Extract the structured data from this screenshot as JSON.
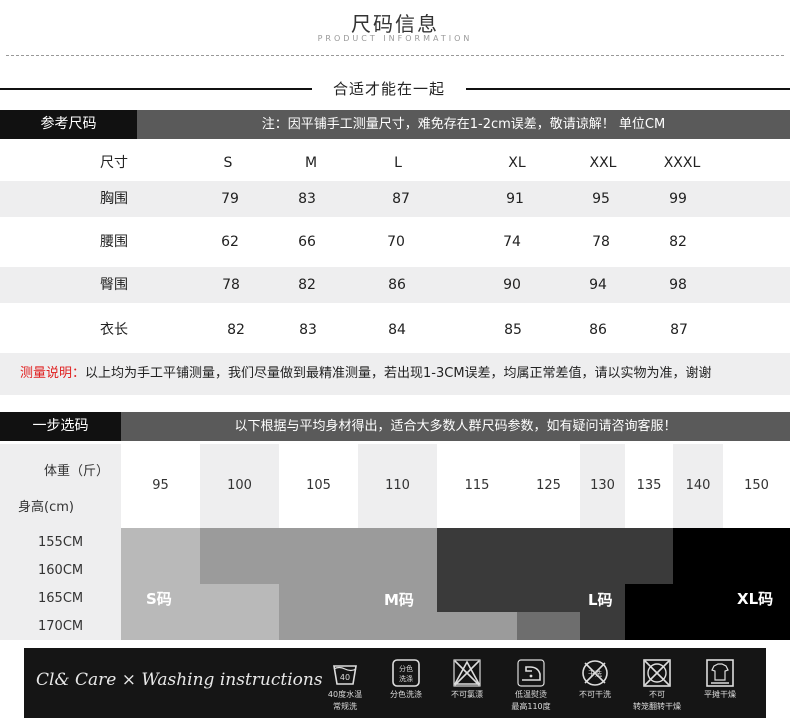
{
  "header": {
    "title": "尺码信息",
    "subtitle": "PRODUCT INFORMATION",
    "slogan": "合适才能在一起"
  },
  "ref": {
    "label": "参考尺码",
    "note": "注：因平铺手工测量尺寸，难免存在1-2cm误差，敬请谅解！ 单位CM"
  },
  "size_table": {
    "header": [
      "尺寸",
      "S",
      "M",
      "L",
      "XL",
      "XXL",
      "XXXL"
    ],
    "rows": [
      [
        "胸围",
        "79",
        "83",
        "87",
        "91",
        "95",
        "99"
      ],
      [
        "腰围",
        "62",
        "66",
        "70",
        "74",
        "78",
        "82"
      ],
      [
        "臀围",
        "78",
        "82",
        "86",
        "90",
        "94",
        "98"
      ],
      [
        "衣长",
        "82",
        "83",
        "84",
        "85",
        "86",
        "87"
      ]
    ]
  },
  "measure_note": {
    "label": "测量说明：",
    "text": "以上均为手工平铺测量，我们尽量做到最精准测量，若出现1-3CM误差，均属正常差值，请以实物为准，谢谢"
  },
  "quick": {
    "label": "一步选码",
    "note": "以下根据与平均身材得出，适合大多数人群尺码参数，如有疑问请咨询客服！",
    "weight_label": "体重（斤）",
    "height_label": "身高(cm)",
    "weights": [
      "95",
      "100",
      "105",
      "110",
      "115",
      "125",
      "130",
      "135",
      "140",
      "150"
    ],
    "heights": [
      "155CM",
      "160CM",
      "165CM",
      "170CM"
    ],
    "sizes": [
      "S码",
      "M码",
      "L码",
      "XL码"
    ]
  },
  "washing": {
    "title": "Cl& Care  × Washing instructions",
    "icons": [
      {
        "name": "wash-40-icon",
        "cap1": "40度水温",
        "cap2": "常规洗",
        "num": "40"
      },
      {
        "name": "separate-wash-icon",
        "cap1": "分色洗涤",
        "cap2": "",
        "box": "分色洗涤"
      },
      {
        "name": "no-bleach-icon",
        "cap1": "不可氯漂",
        "cap2": ""
      },
      {
        "name": "low-iron-icon",
        "cap1": "低温熨烫",
        "cap2": "最高110度"
      },
      {
        "name": "no-dryclean-icon",
        "cap1": "不可干洗",
        "cap2": "",
        "mark": "干洗"
      },
      {
        "name": "no-tumble-icon",
        "cap1": "不可",
        "cap2": "转笼翻转干燥"
      },
      {
        "name": "flat-dry-icon",
        "cap1": "平摊干燥",
        "cap2": ""
      }
    ]
  },
  "colors": {
    "dark": "#111111",
    "bar_grey": "#5a5a5a",
    "row_shade": "#eeeeef",
    "note_red": "#e02020",
    "s_block": "#b9b9b9",
    "m_block": "#9b9b9b",
    "l_block": "#3a3a3a",
    "xl_block": "#000000"
  }
}
